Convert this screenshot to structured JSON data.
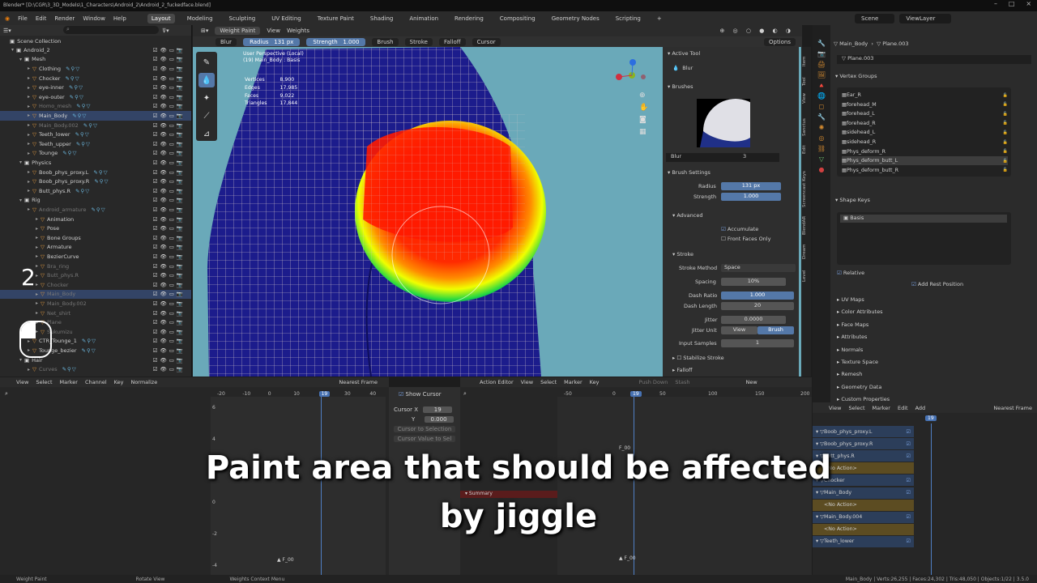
{
  "window": {
    "title": "Blender* [D:\\CGR\\3_3D_Models\\1_Characters\\Android_2\\Android_2_fuckedface.blend]"
  },
  "menu": {
    "items": [
      "File",
      "Edit",
      "Render",
      "Window",
      "Help"
    ],
    "workspaces": [
      "Layout",
      "Modeling",
      "Sculpting",
      "UV Editing",
      "Texture Paint",
      "Shading",
      "Animation",
      "Rendering",
      "Compositing",
      "Geometry Nodes",
      "Scripting",
      "+"
    ],
    "active_workspace": "Layout",
    "scene": "Scene",
    "view_layer": "ViewLayer"
  },
  "outliner": {
    "root": "Scene Collection",
    "rows": [
      {
        "label": "Android_2",
        "depth": 1,
        "type": "collection"
      },
      {
        "label": "Mesh",
        "depth": 2,
        "type": "collection"
      },
      {
        "label": "Clothing",
        "depth": 3,
        "type": "object"
      },
      {
        "label": "Chocker",
        "depth": 3,
        "type": "object"
      },
      {
        "label": "eye-inner",
        "depth": 3,
        "type": "object"
      },
      {
        "label": "eye-outer",
        "depth": 3,
        "type": "object"
      },
      {
        "label": "Homo_mesh",
        "depth": 3,
        "type": "object",
        "dim": true
      },
      {
        "label": "Main_Body",
        "depth": 3,
        "type": "object",
        "selected": true
      },
      {
        "label": "Main_Body.002",
        "depth": 3,
        "type": "object",
        "dim": true
      },
      {
        "label": "Teeth_lower",
        "depth": 3,
        "type": "object"
      },
      {
        "label": "Teeth_upper",
        "depth": 3,
        "type": "object"
      },
      {
        "label": "Tounge",
        "depth": 3,
        "type": "object"
      },
      {
        "label": "Physics",
        "depth": 2,
        "type": "collection"
      },
      {
        "label": "Boob_phys_proxy.L",
        "depth": 3,
        "type": "object"
      },
      {
        "label": "Boob_phys_proxy.R",
        "depth": 3,
        "type": "object"
      },
      {
        "label": "Butt_phys.R",
        "depth": 3,
        "type": "object"
      },
      {
        "label": "Rig",
        "depth": 2,
        "type": "collection"
      },
      {
        "label": "Android_armature",
        "depth": 3,
        "type": "object",
        "dim": true
      },
      {
        "label": "Animation",
        "depth": 4,
        "type": "item"
      },
      {
        "label": "Pose",
        "depth": 4,
        "type": "item"
      },
      {
        "label": "Bone Groups",
        "depth": 4,
        "type": "item"
      },
      {
        "label": "Armature",
        "depth": 4,
        "type": "item"
      },
      {
        "label": "BezierCurve",
        "depth": 4,
        "type": "item"
      },
      {
        "label": "Bra_ring",
        "depth": 4,
        "type": "item",
        "dim": true
      },
      {
        "label": "Butt_phys.R",
        "depth": 4,
        "type": "item",
        "dim": true
      },
      {
        "label": "Chocker",
        "depth": 4,
        "type": "item",
        "dim": true
      },
      {
        "label": "Main_Body",
        "depth": 4,
        "type": "item",
        "dim": true,
        "selected": true
      },
      {
        "label": "Main_Body.002",
        "depth": 4,
        "type": "item",
        "dim": true
      },
      {
        "label": "Net_shirt",
        "depth": 4,
        "type": "item",
        "dim": true
      },
      {
        "label": "Plane",
        "depth": 4,
        "type": "item",
        "dim": true
      },
      {
        "label": "Sukumizu",
        "depth": 4,
        "type": "item",
        "dim": true
      },
      {
        "label": "CTR_Tounge_1",
        "depth": 3,
        "type": "object"
      },
      {
        "label": "Tounge_bezier",
        "depth": 3,
        "type": "object"
      },
      {
        "label": "Hair",
        "depth": 2,
        "type": "collection"
      },
      {
        "label": "Curves",
        "depth": 3,
        "type": "object",
        "dim": true
      }
    ]
  },
  "overlay_number": "2",
  "viewport": {
    "mode": "Weight Paint",
    "header_items": [
      "View",
      "Weights"
    ],
    "tool_name": "Blur",
    "radius_label": "Radius",
    "radius_value": "131 px",
    "strength_label": "Strength",
    "strength_value": "1.000",
    "header_dropdowns": [
      "Brush",
      "Stroke",
      "Falloff",
      "Cursor"
    ],
    "options": "Options",
    "perspective": "User Perspective (Local)",
    "object_info": "(19) Main_Body : Basis",
    "stats": [
      {
        "label": "Vertices",
        "value": "8,900"
      },
      {
        "label": "Edges",
        "value": "17,985"
      },
      {
        "label": "Faces",
        "value": "9,022"
      },
      {
        "label": "Triangles",
        "value": "17,844"
      }
    ]
  },
  "sidebar": {
    "active_tool_title": "Active Tool",
    "active_tool": "Blur",
    "brushes_title": "Brushes",
    "brush_name": "Blur",
    "brush_users": "3",
    "brush_settings_title": "Brush Settings",
    "radius_label": "Radius",
    "radius_value": "131 px",
    "strength_label": "Strength",
    "strength_value": "1.000",
    "advanced_title": "Advanced",
    "accumulate": "Accumulate",
    "front_faces": "Front Faces Only",
    "stroke_title": "Stroke",
    "stroke_method_label": "Stroke Method",
    "stroke_method_value": "Space",
    "spacing_label": "Spacing",
    "spacing_value": "10%",
    "dash_ratio_label": "Dash Ratio",
    "dash_ratio_value": "1.000",
    "dash_length_label": "Dash Length",
    "dash_length_value": "20",
    "jitter_label": "Jitter",
    "jitter_value": "0.0000",
    "jitter_unit_label": "Jitter Unit",
    "jitter_unit_view": "View",
    "jitter_unit_brush": "Brush",
    "input_samples_label": "Input Samples",
    "input_samples_value": "1",
    "stabilize": "Stabilize Stroke",
    "falloff_title": "Falloff",
    "tabs": [
      "Item",
      "Tool",
      "View",
      "Sanctus",
      "Edit",
      "Screencast Keys",
      "BlendAR",
      "Dream",
      "Level"
    ]
  },
  "properties": {
    "object": "Main_Body",
    "mesh": "Plane.003",
    "data_name": "Plane.003",
    "vertex_groups_title": "Vertex Groups",
    "vertex_groups": [
      "Ear_R",
      "forehead_M",
      "forehead_L",
      "forehead_R",
      "sidehead_L",
      "sidehead_R",
      "Phys_deform_R",
      "Phys_deform_butt_L",
      "Phys_deform_butt_R"
    ],
    "selected_vg": "Phys_deform_butt_L",
    "shape_keys_title": "Shape Keys",
    "shape_key": "Basis",
    "relative": "Relative",
    "add_rest": "Add Rest Position",
    "panels": [
      "UV Maps",
      "Color Attributes",
      "Face Maps",
      "Attributes",
      "Normals",
      "Texture Space",
      "Remesh",
      "Geometry Data",
      "Custom Properties"
    ]
  },
  "graph": {
    "header": [
      "View",
      "Select",
      "Marker",
      "Channel",
      "Key",
      "Normalize"
    ],
    "ruler": [
      "-20",
      "-10",
      "0",
      "10",
      "19",
      "30",
      "40"
    ],
    "yticks": [
      "6",
      "4",
      "2",
      "0",
      "-2",
      "-4"
    ],
    "marker": "F_00",
    "show_cursor": "Show Cursor",
    "cursor_x_label": "Cursor X",
    "cursor_x_value": "19",
    "cursor_y_label": "Y",
    "cursor_y_value": "0.000",
    "cursor_to_sel": "Cursor to Selection",
    "cursor_value_to_sel": "Cursor Value to Sel"
  },
  "action_editor": {
    "mode": "Action Editor",
    "header": [
      "View",
      "Select",
      "Marker",
      "Key"
    ],
    "push_down": "Push Down",
    "stash": "Stash",
    "new": "New",
    "ruler": [
      "-50",
      "0",
      "19",
      "50",
      "100",
      "150",
      "200"
    ],
    "marker": "F_00",
    "summary": "Summary"
  },
  "nla": {
    "header": [
      "View",
      "Select",
      "Marker",
      "Edit",
      "Add"
    ],
    "nearest": "Nearest Frame",
    "frame": "19",
    "tracks": [
      {
        "label": "Boob_phys_proxy.L",
        "kind": "blue"
      },
      {
        "label": "Boob_phys_proxy.R",
        "kind": "blue"
      },
      {
        "label": "Butt_phys.R",
        "kind": "blue"
      },
      {
        "label": "<No Action>",
        "kind": "gold"
      },
      {
        "label": "Chocker",
        "kind": "blue"
      },
      {
        "label": "Main_Body",
        "kind": "blue"
      },
      {
        "label": "<No Action>",
        "kind": "gold"
      },
      {
        "label": "Main_Body.004",
        "kind": "blue"
      },
      {
        "label": "<No Action>",
        "kind": "gold"
      },
      {
        "label": "Teeth_lower",
        "kind": "blue"
      }
    ]
  },
  "graph_nearest": "Nearest Frame",
  "status": {
    "left": "Weight Paint",
    "mid": "Rotate View",
    "mid2": "Weights Context Menu",
    "right": "Main_Body | Verts:26,255 | Faces:24,302 | Tris:48,050 | Objects:1/22 | 3.5.0"
  },
  "caption": {
    "line1": "Paint area that should be affected",
    "line2": "by jiggle"
  }
}
